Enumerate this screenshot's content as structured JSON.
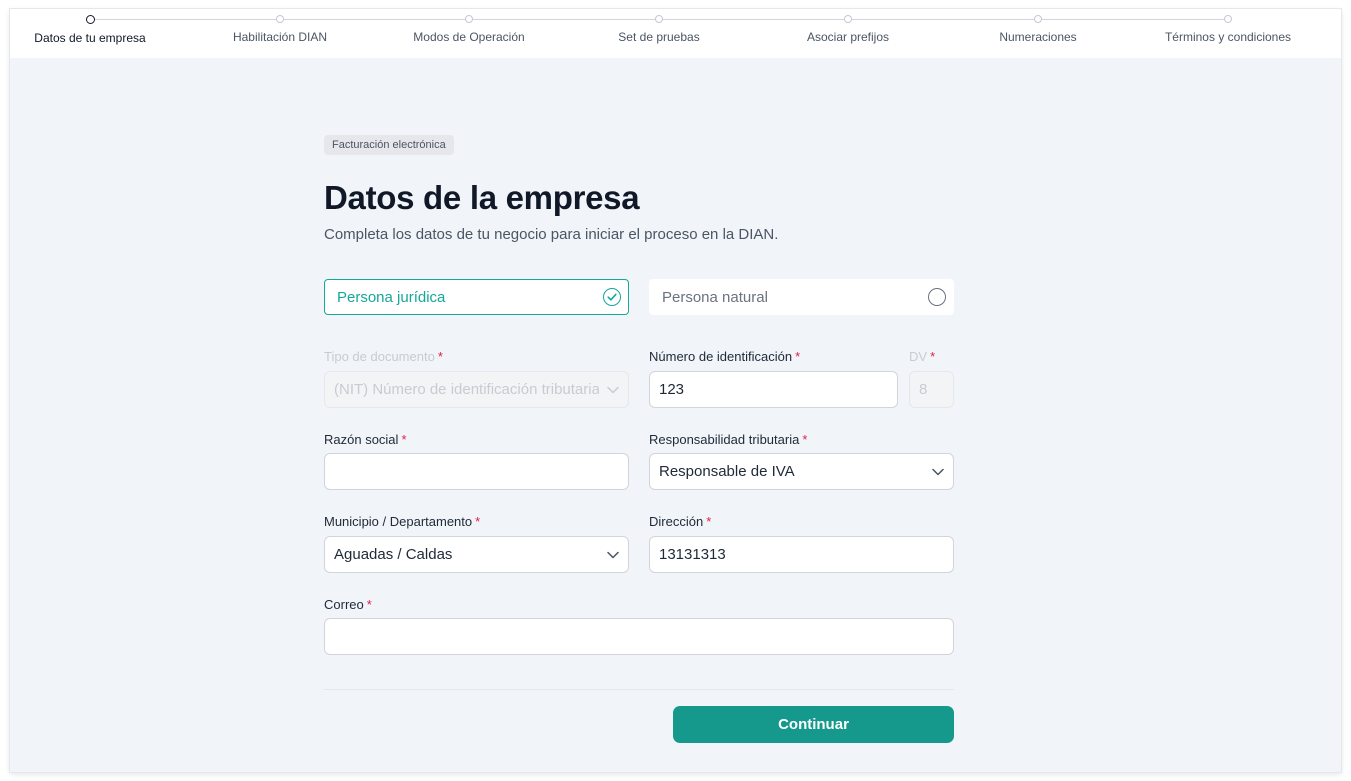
{
  "stepper": {
    "steps": [
      {
        "label": "Datos de tu empresa",
        "active": true
      },
      {
        "label": "Habilitación DIAN",
        "active": false
      },
      {
        "label": "Modos de Operación",
        "active": false
      },
      {
        "label": "Set de pruebas",
        "active": false
      },
      {
        "label": "Asociar prefijos",
        "active": false
      },
      {
        "label": "Numeraciones",
        "active": false
      },
      {
        "label": "Términos y condiciones",
        "active": false
      }
    ]
  },
  "header": {
    "badge": "Facturación electrónica",
    "title": "Datos de la empresa",
    "subtitle": "Completa los datos de tu negocio para iniciar el proceso en la DIAN."
  },
  "person_type": {
    "juridica": "Persona jurídica",
    "natural": "Persona natural",
    "selected": "juridica"
  },
  "form": {
    "tipo_documento": {
      "label": "Tipo de documento",
      "value": "(NIT) Número de identificación tributaria",
      "disabled": true
    },
    "numero_identificacion": {
      "label": "Número de identificación",
      "value": "123"
    },
    "dv": {
      "label": "DV",
      "value": "8",
      "disabled": true
    },
    "razon_social": {
      "label": "Razón social",
      "value": ""
    },
    "responsabilidad": {
      "label": "Responsabilidad tributaria",
      "value": "Responsable de IVA"
    },
    "municipio": {
      "label": "Municipio / Departamento",
      "value": "Aguadas / Caldas"
    },
    "direccion": {
      "label": "Dirección",
      "value": "13131313"
    },
    "correo": {
      "label": "Correo",
      "value": ""
    },
    "required_mark": "*"
  },
  "actions": {
    "continue_label": "Continuar"
  },
  "colors": {
    "accent": "#14a89a",
    "button": "#14998c",
    "required": "#e11d48",
    "background": "#f1f5f9"
  }
}
